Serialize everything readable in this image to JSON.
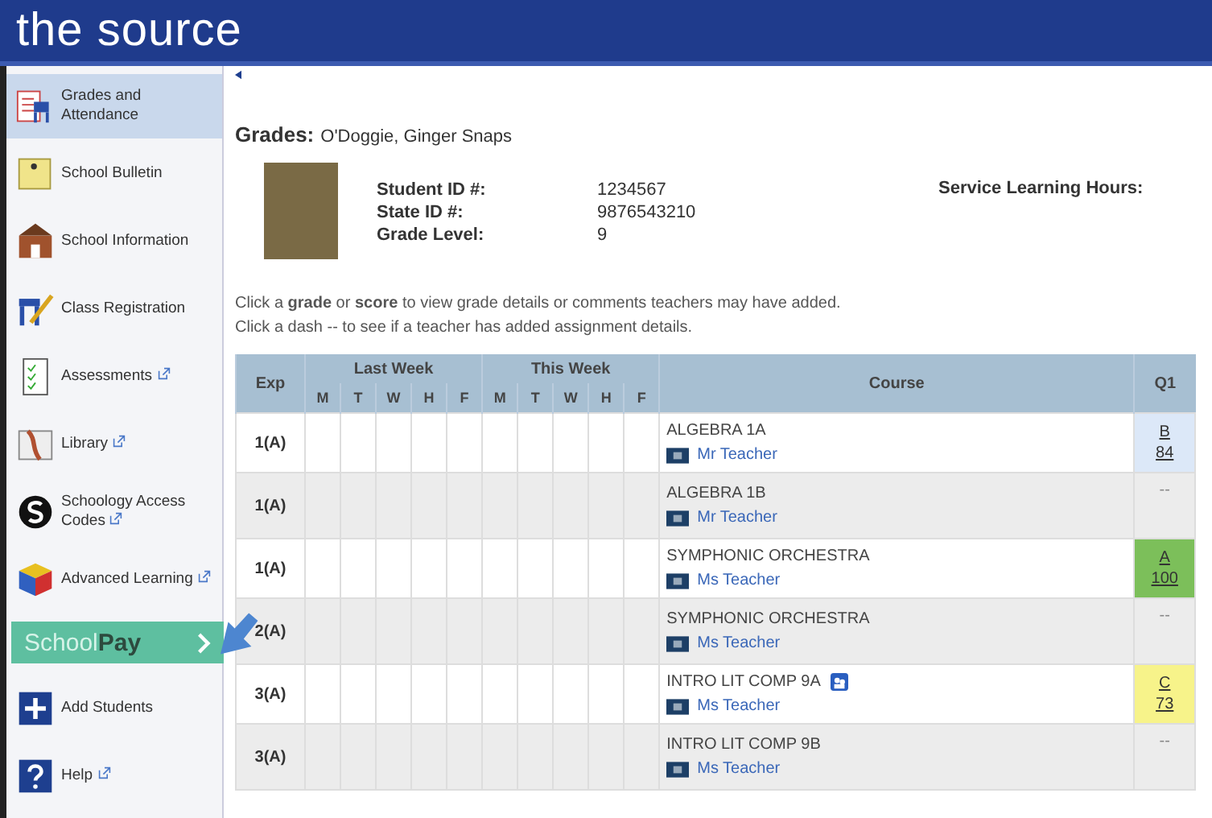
{
  "header": {
    "title": "the source"
  },
  "sidebar": {
    "items": [
      {
        "kind": "nav",
        "label": "Grades and Attendance",
        "external": false,
        "selected": true
      },
      {
        "kind": "nav",
        "label": "School Bulletin",
        "external": false,
        "selected": false
      },
      {
        "kind": "nav",
        "label": "School Information",
        "external": false,
        "selected": false
      },
      {
        "kind": "nav",
        "label": "Class Registration",
        "external": false,
        "selected": false
      },
      {
        "kind": "nav",
        "label": "Assessments",
        "external": true,
        "selected": false
      },
      {
        "kind": "nav",
        "label": "Library",
        "external": true,
        "selected": false
      },
      {
        "kind": "nav",
        "label": "Schoology Access Codes",
        "external": true,
        "selected": false
      },
      {
        "kind": "nav",
        "label": "Advanced Learning",
        "external": true,
        "selected": false
      },
      {
        "kind": "pay",
        "label_a": "School",
        "label_b": "Pay"
      },
      {
        "kind": "nav",
        "label": "Add Students",
        "external": false,
        "selected": false
      },
      {
        "kind": "nav",
        "label": "Help",
        "external": true,
        "selected": false
      }
    ]
  },
  "student": {
    "heading": "Grades:",
    "name": "O'Doggie, Ginger Snaps",
    "fields": [
      {
        "label": "Student ID #:",
        "value": "1234567"
      },
      {
        "label": "State ID #:",
        "value": "9876543210"
      },
      {
        "label": "Grade Level:",
        "value": "9"
      }
    ],
    "service_label": "Service Learning Hours:"
  },
  "instructions": [
    "Click a **grade** or **score** to view grade details or comments teachers may have added.",
    "Click a dash -- to see if a teacher has added assignment details."
  ],
  "table": {
    "exp_header": "Exp",
    "weeks": [
      {
        "label": "Last Week",
        "days": [
          "M",
          "T",
          "W",
          "H",
          "F"
        ]
      },
      {
        "label": "This Week",
        "days": [
          "M",
          "T",
          "W",
          "H",
          "F"
        ]
      }
    ],
    "course_header": "Course",
    "q1_header": "Q1",
    "rows": [
      {
        "exp": "1(A)",
        "course": "ALGEBRA 1A",
        "teacher": "Mr Teacher",
        "badge": false,
        "grade": {
          "letter": "B",
          "score": "84",
          "color": "#dce8f8"
        }
      },
      {
        "exp": "1(A)",
        "course": "ALGEBRA 1B",
        "teacher": "Mr Teacher",
        "badge": false,
        "dash": "--"
      },
      {
        "exp": "1(A)",
        "course": "SYMPHONIC ORCHESTRA",
        "teacher": "Ms Teacher",
        "badge": false,
        "grade": {
          "letter": "A",
          "score": "100",
          "color": "#7cbf5a"
        }
      },
      {
        "exp": "2(A)",
        "course": "SYMPHONIC ORCHESTRA",
        "teacher": "Ms Teacher",
        "badge": false,
        "dash": "--"
      },
      {
        "exp": "3(A)",
        "course": "INTRO LIT COMP 9A",
        "teacher": "Ms Teacher",
        "badge": true,
        "grade": {
          "letter": "C",
          "score": "73",
          "color": "#f7f38a"
        }
      },
      {
        "exp": "3(A)",
        "course": "INTRO LIT COMP 9B",
        "teacher": "Ms Teacher",
        "badge": false,
        "dash": "--"
      }
    ]
  }
}
